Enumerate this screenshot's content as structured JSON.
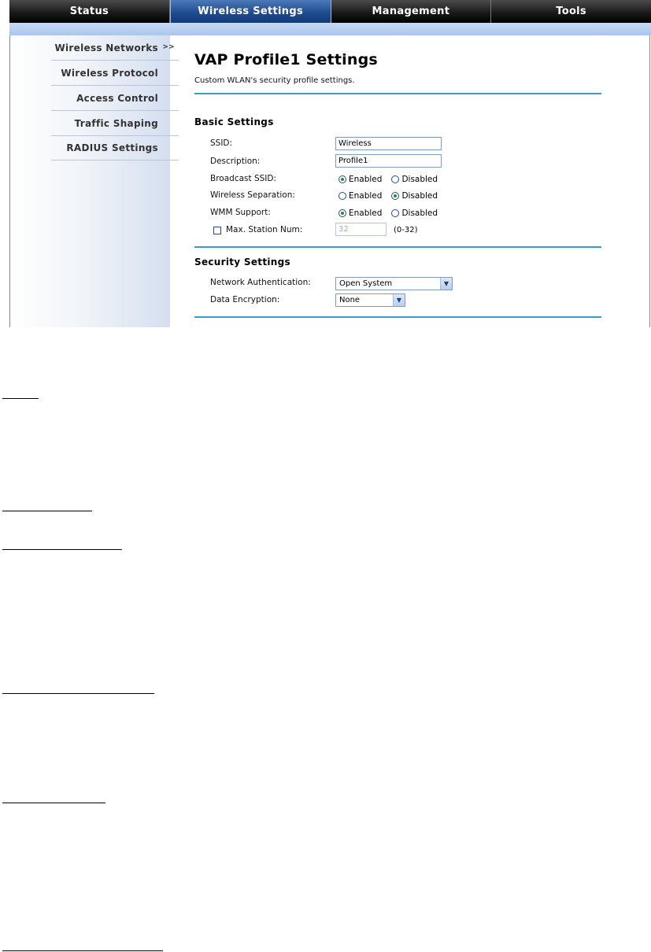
{
  "topnav": {
    "tabs": [
      {
        "label": "Status"
      },
      {
        "label": "Wireless Settings"
      },
      {
        "label": "Management"
      },
      {
        "label": "Tools"
      }
    ],
    "active": "Wireless Settings"
  },
  "sidebar": {
    "items": [
      {
        "label": "Wireless Networks",
        "arrow": ">>"
      },
      {
        "label": "Wireless Protocol"
      },
      {
        "label": "Access Control"
      },
      {
        "label": "Traffic Shaping"
      },
      {
        "label": "RADIUS Settings"
      }
    ]
  },
  "page": {
    "title": "VAP Profile1 Settings",
    "description": "Custom WLAN's security profile settings."
  },
  "basic": {
    "title": "Basic Settings",
    "ssid_label": "SSID:",
    "ssid_value": "Wireless",
    "description_label": "Description:",
    "description_value": "Profile1",
    "broadcast_label": "Broadcast SSID:",
    "separation_label": "Wireless Separation:",
    "wmm_label": "WMM Support:",
    "enabled_label": "Enabled",
    "disabled_label": "Disabled",
    "broadcast_selected": "Enabled",
    "separation_selected": "Disabled",
    "wmm_selected": "Enabled",
    "max_station_label": "Max. Station Num:",
    "max_station_value": "32",
    "max_station_range": "(0-32)"
  },
  "security": {
    "title": "Security Settings",
    "auth_label": "Network Authentication:",
    "auth_value": "Open System",
    "encryption_label": "Data Encryption:",
    "encryption_value": "None"
  },
  "colors": {
    "accent": "#3a9bc8",
    "active_tab": "#1f4d91",
    "subbar": "#b4cdef"
  }
}
